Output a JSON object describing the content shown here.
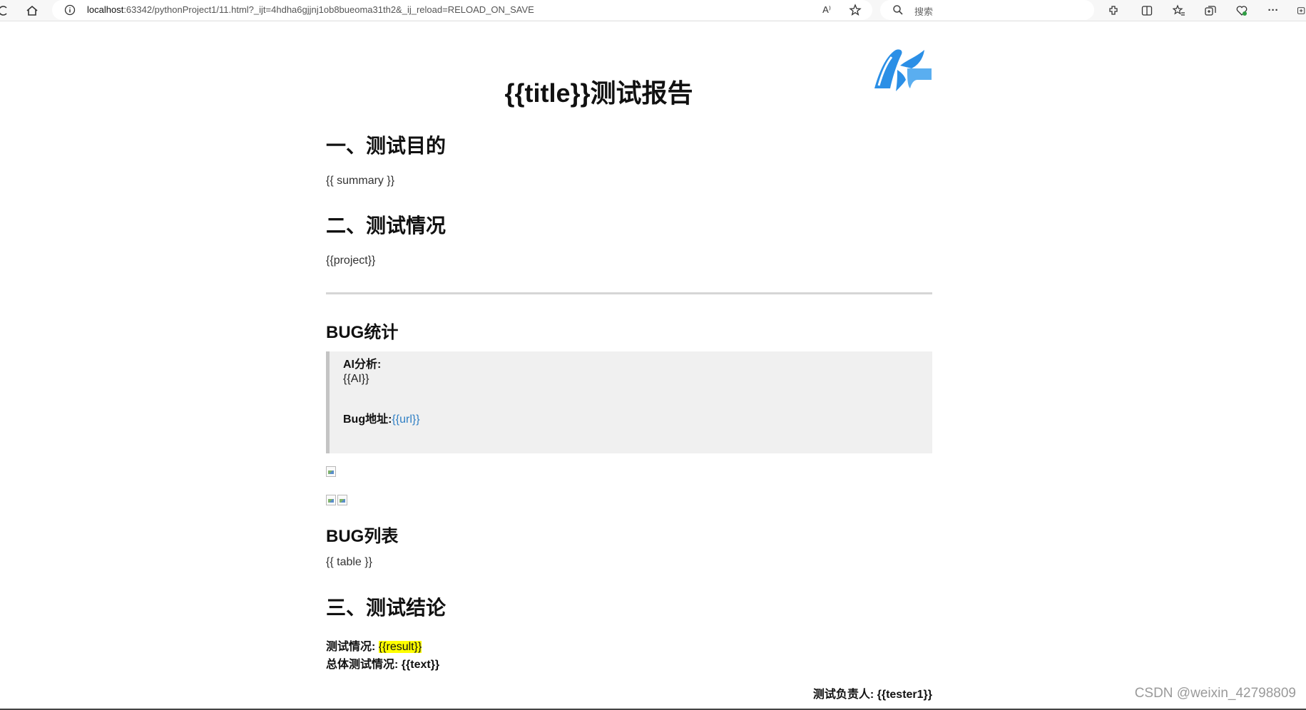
{
  "browser": {
    "url_host": "localhost",
    "url_rest": ":63342/pythonProject1/11.html?_ijt=4hdha6gjjnj1ob8bueoma31th2&_ij_reload=RELOAD_ON_SAVE",
    "search_placeholder": "搜索",
    "read_aloud_label": "A⁾",
    "more_label": "···"
  },
  "report": {
    "title": "{{title}}测试报告",
    "section1": {
      "heading": "一、测试目的",
      "body": "{{ summary }}"
    },
    "section2": {
      "heading": "二、测试情况",
      "body": "{{project}}"
    },
    "bug_stats": {
      "heading": "BUG统计",
      "ai_label": "AI分析:",
      "ai_value": "{{AI}}",
      "bug_url_label": "Bug地址:",
      "bug_url_value": "{{url}}"
    },
    "bug_list": {
      "heading": "BUG列表",
      "body": "{{ table }}"
    },
    "section3": {
      "heading": "三、测试结论",
      "result_label": "测试情况:",
      "result_value": "{{result}}",
      "overall_label": "总体测试情况:",
      "overall_value": "{{text}}"
    },
    "tester_label": "测试负责人:",
    "tester_value": "{{tester1}}"
  },
  "watermark": "CSDN @weixin_42798809",
  "colors": {
    "link": "#2f7fc4",
    "highlight": "#ffff00",
    "quote_bg": "#f0f0f0",
    "logo": "#2b8fe6"
  }
}
